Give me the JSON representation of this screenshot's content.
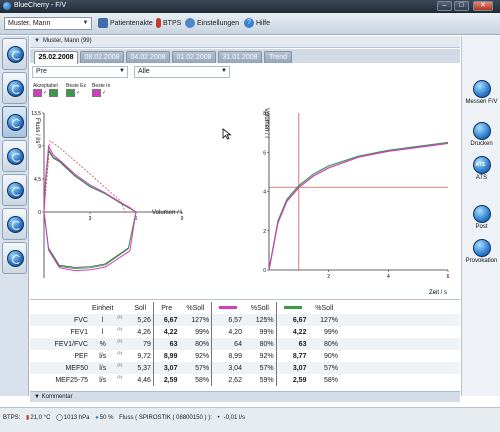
{
  "window": {
    "title": "BlueCherry - F/V"
  },
  "toolbar": {
    "patient": "Muster, Mann",
    "patientenakte": "Patientenakte",
    "btps": "BTPS",
    "einstellungen": "Einstellungen",
    "hilfe": "Hilfe"
  },
  "patient_header": "Muster, Mann (99)",
  "tabs": [
    "25.02.2008",
    "08.02.2008",
    "04.02.2008",
    "01.02.2008",
    "31.01.2008",
    "Trend"
  ],
  "filters": {
    "left": "Pre",
    "right": "Alle"
  },
  "legend": {
    "akzeptabel": "Akzeptabel",
    "beste_ex": "Beste Ex",
    "beste_in": "Beste In"
  },
  "colors": {
    "pre": "#2a2a2a",
    "series_magenta": "#d23dbf",
    "series_green": "#3a9a4a",
    "soll": "#c83a3a"
  },
  "fv_chart": {
    "ylabel": "Fluss / l/s",
    "xlabel": "Volumen / l",
    "yticks": [
      "13,5",
      "9",
      "4,5",
      "0"
    ],
    "xticks": [
      "3",
      "6",
      "9"
    ]
  },
  "vt_chart": {
    "ylabel": "Volumen / l",
    "xlabel": "Zeit / s",
    "yticks": [
      "8",
      "6",
      "4",
      "2",
      "0"
    ],
    "xticks": [
      "2",
      "4",
      "6"
    ]
  },
  "chart_data": [
    {
      "type": "line",
      "title": "",
      "xlabel": "Volumen / l",
      "ylabel": "Fluss / l/s",
      "xlim": [
        0,
        9
      ],
      "ylim": [
        -9,
        13.5
      ],
      "series": [
        {
          "name": "Beste Ex",
          "x": [
            0,
            0.1,
            0.3,
            0.6,
            1,
            2,
            3,
            4,
            5,
            5.5,
            6,
            5.5,
            4,
            3,
            2,
            1,
            0.3,
            0
          ],
          "y": [
            0,
            4,
            8.5,
            7.5,
            7,
            5,
            3.5,
            2.5,
            1.2,
            0.6,
            0,
            -5,
            -7.2,
            -7.6,
            -7.7,
            -7.4,
            -5,
            0
          ]
        },
        {
          "name": "Beste In",
          "x": [
            0,
            0.1,
            0.3,
            0.6,
            1,
            2,
            3,
            4,
            5,
            5.6,
            6,
            5.6,
            4,
            3,
            2,
            1,
            0.3,
            0
          ],
          "y": [
            0,
            4.5,
            9,
            7.8,
            7.1,
            5.2,
            3.7,
            2.6,
            1.3,
            0.6,
            0,
            -5.3,
            -7.5,
            -7.9,
            -8,
            -7.6,
            -5.2,
            0
          ]
        }
      ]
    },
    {
      "type": "line",
      "title": "",
      "xlabel": "Zeit / s",
      "ylabel": "Volumen / l",
      "xlim": [
        0,
        6
      ],
      "ylim": [
        0,
        8
      ],
      "series": [
        {
          "name": "Beste Ex",
          "x": [
            0,
            0.3,
            0.6,
            1,
            1.5,
            2,
            3,
            4,
            5,
            6
          ],
          "y": [
            0,
            2.5,
            3.6,
            4.3,
            4.9,
            5.3,
            5.8,
            6.1,
            6.3,
            6.5
          ]
        },
        {
          "name": "Beste In",
          "x": [
            0,
            0.3,
            0.6,
            1,
            1.5,
            2,
            3,
            4,
            5,
            6
          ],
          "y": [
            0,
            2.4,
            3.5,
            4.2,
            4.8,
            5.2,
            5.75,
            6.05,
            6.25,
            6.45
          ]
        }
      ]
    }
  ],
  "table": {
    "headers": [
      "Einheit",
      "Soll",
      "Pre",
      "%Soll",
      "%Soll",
      "%Soll"
    ],
    "rows": [
      {
        "name": "FVC",
        "unit": "l",
        "note": "(1)",
        "soll": "5,26",
        "pre": "6,67",
        "pre_pct": "127%",
        "m": "6,57",
        "m_pct": "125%",
        "g": "6,67",
        "g_pct": "127%"
      },
      {
        "name": "FEV1",
        "unit": "l",
        "note": "(1)",
        "soll": "4,26",
        "pre": "4,22",
        "pre_pct": "99%",
        "m": "4,20",
        "m_pct": "99%",
        "g": "4,22",
        "g_pct": "99%"
      },
      {
        "name": "FEV1/FVC",
        "unit": "%",
        "note": "(1)",
        "soll": "79",
        "pre": "63",
        "pre_pct": "80%",
        "m": "64",
        "m_pct": "80%",
        "g": "63",
        "g_pct": "80%"
      },
      {
        "name": "PEF",
        "unit": "l/s",
        "note": "(1)",
        "soll": "9,72",
        "pre": "8,99",
        "pre_pct": "92%",
        "m": "8,99",
        "m_pct": "92%",
        "g": "8,77",
        "g_pct": "90%"
      },
      {
        "name": "MEF50",
        "unit": "l/s",
        "note": "(1)",
        "soll": "5,37",
        "pre": "3,07",
        "pre_pct": "57%",
        "m": "3,04",
        "m_pct": "57%",
        "g": "3,07",
        "g_pct": "57%"
      },
      {
        "name": "MEF25-75",
        "unit": "l/s",
        "note": "(1)",
        "soll": "4,46",
        "pre": "2,59",
        "pre_pct": "58%",
        "m": "2,62",
        "m_pct": "59%",
        "g": "2,59",
        "g_pct": "58%"
      }
    ]
  },
  "right_menu": {
    "messen": "Messen F/V",
    "drucken": "Drucken",
    "ats": "ATS",
    "post": "Post",
    "provokation": "Provokation"
  },
  "kommentar": "Kommentar",
  "status": {
    "btps": "BTPS:",
    "temp": "21,0 °C",
    "pressure": "1013 hPa",
    "humidity": "50 %",
    "device": "Fluss ( SPIROSTIK ( 08800150 ) ):",
    "value": "-0,01 l/s"
  }
}
